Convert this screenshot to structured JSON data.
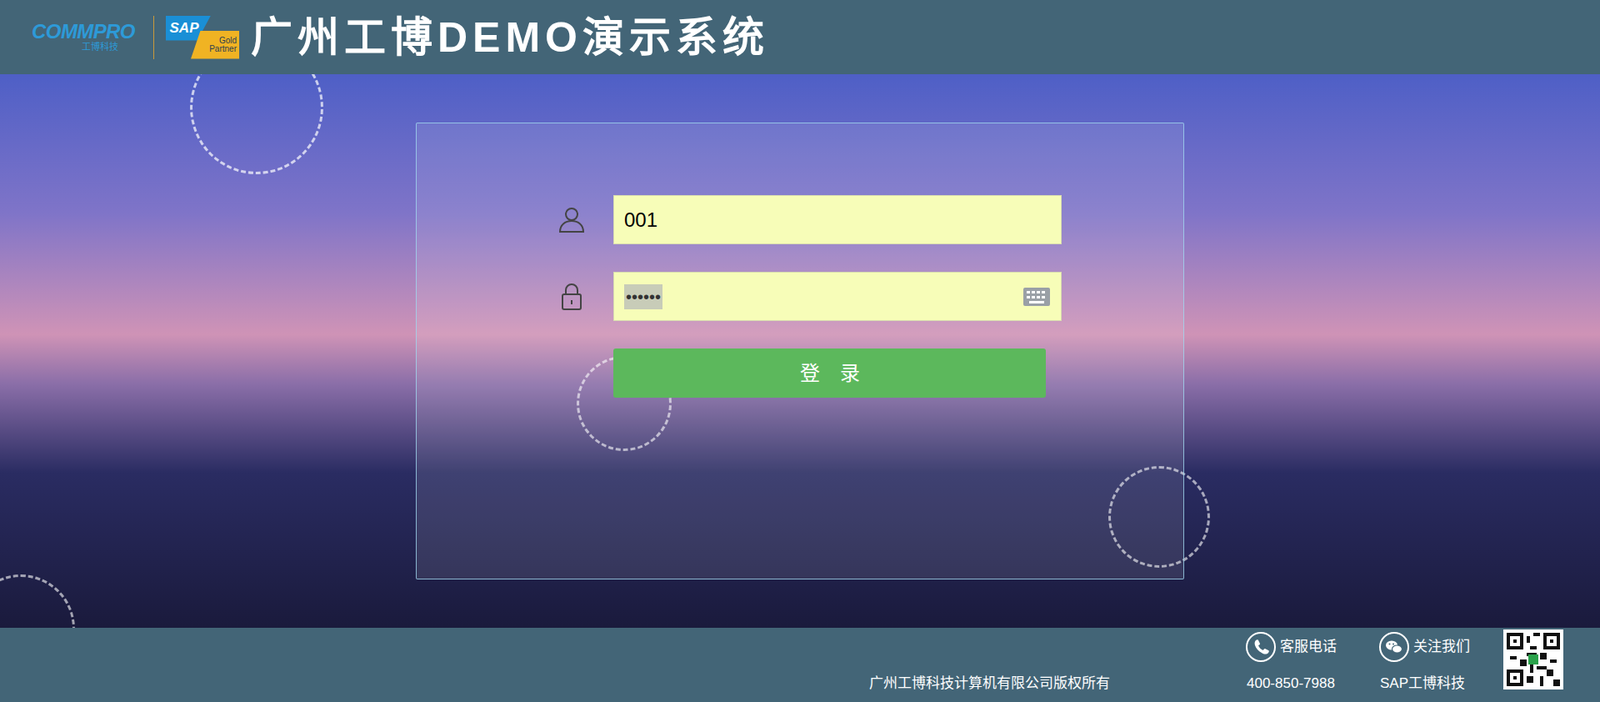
{
  "header": {
    "title": "广州工博DEMO演示系统",
    "logo": {
      "brand": "COMMPRO",
      "subtitle": "工博科技"
    },
    "partner_logo": {
      "brand": "SAP",
      "line1": "Gold",
      "line2": "Partner"
    }
  },
  "login": {
    "username": {
      "value": "001"
    },
    "password": {
      "value": "••••••",
      "text_selected": true
    },
    "button": "登　录"
  },
  "footer": {
    "copyright": "广州工博科技计算机有限公司版权所有",
    "contacts": [
      {
        "label": "客服电话",
        "value": "400-850-7988",
        "kind": "phone"
      },
      {
        "label": "关注我们",
        "value": "SAP工博科技",
        "kind": "wechat"
      }
    ]
  }
}
